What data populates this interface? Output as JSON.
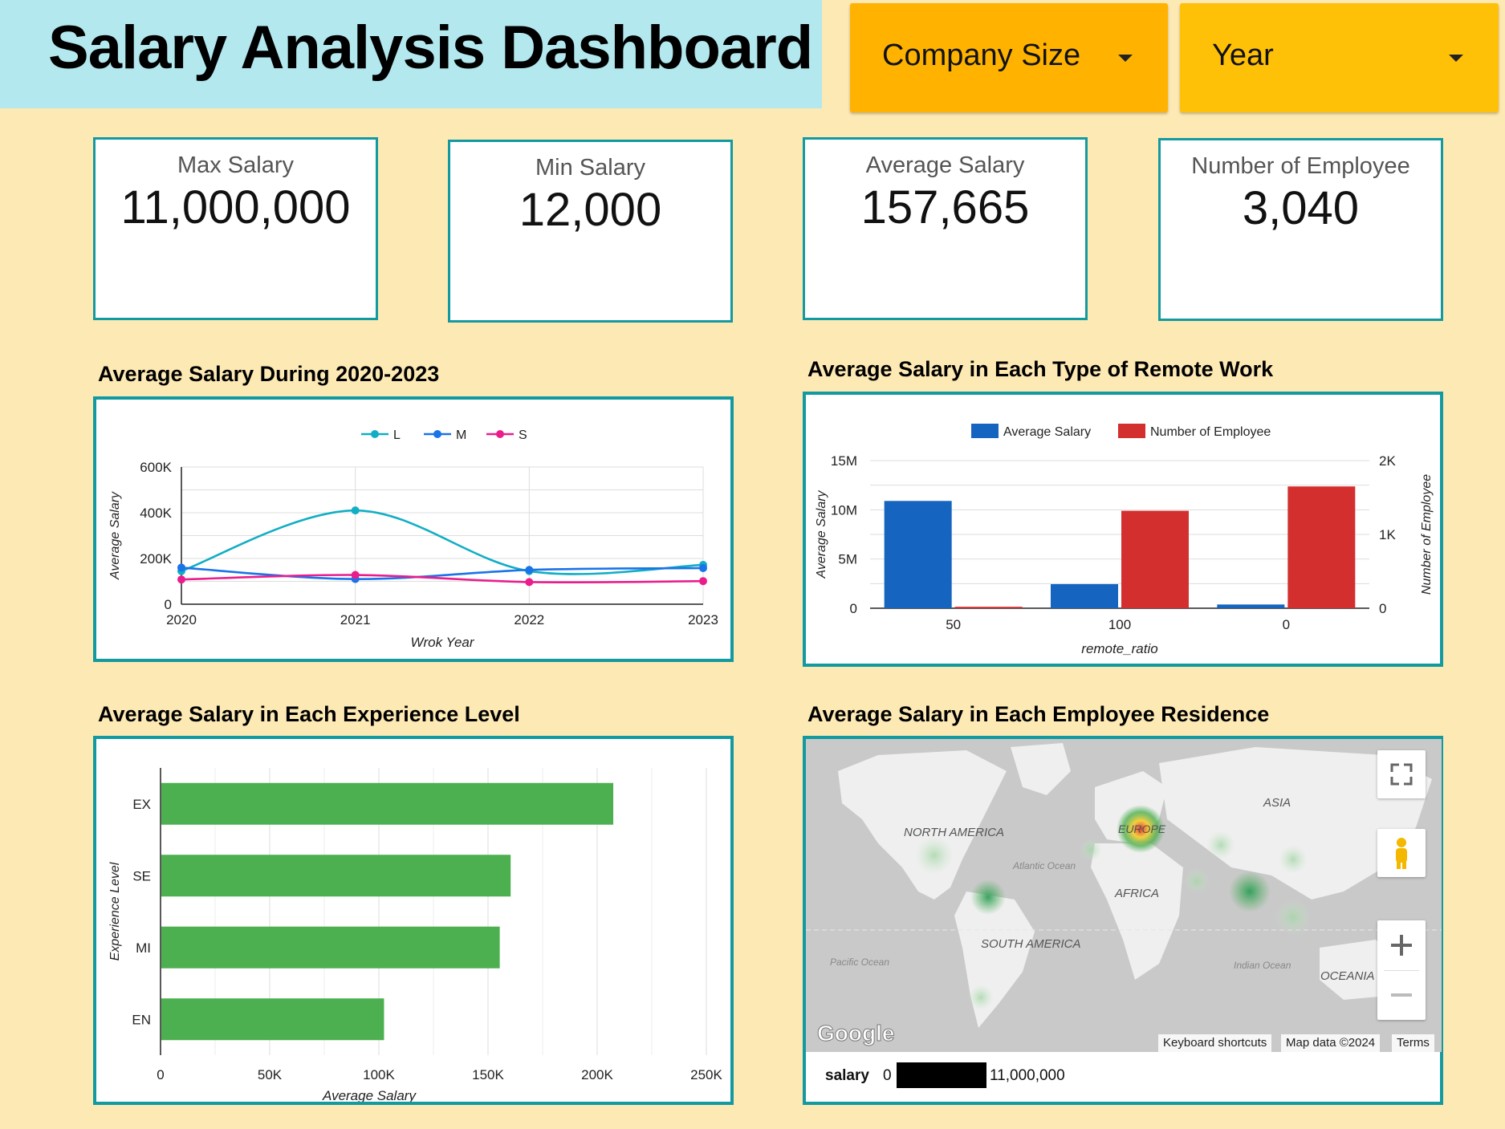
{
  "header": {
    "title": "Salary Analysis Dashboard"
  },
  "filters": {
    "company_size": "Company Size",
    "year": "Year"
  },
  "colors": {
    "teal": "#139aa0",
    "orange": "#ffb300",
    "yellow": "#ffc107",
    "blue": "#1565c0",
    "red": "#d32f2f",
    "green": "#4caf50",
    "pink": "#e91e8c",
    "cyan": "#12aec4"
  },
  "kpis": [
    {
      "label": "Max Salary",
      "value": "11,000,000"
    },
    {
      "label": "Min Salary",
      "value": "12,000"
    },
    {
      "label": "Average Salary",
      "value": "157,665"
    },
    {
      "label": "Number of Employee",
      "value": "3,040"
    }
  ],
  "sections": {
    "line": "Average Salary During 2020-2023",
    "combo": "Average Salary in Each Type of Remote Work",
    "bar": "Average Salary in Each Experience Level",
    "map": "Average Salary in Each Employee Residence"
  },
  "map": {
    "labels": [
      "NORTH AMERICA",
      "SOUTH AMERICA",
      "EUROPE",
      "AFRICA",
      "ASIA",
      "OCEANIA",
      "Atlantic Ocean",
      "Pacific Ocean",
      "Indian Ocean"
    ],
    "google": "Google",
    "attribution": [
      "Keyboard shortcuts",
      "Map data ©2024",
      "Terms"
    ],
    "legend": {
      "field": "salary",
      "min": "0",
      "max": "11,000,000"
    },
    "icons": [
      "fullscreen-icon",
      "pegman-icon",
      "zoom-in-icon",
      "zoom-out-icon"
    ]
  },
  "chart_data": [
    {
      "type": "line",
      "title": "Average Salary During 2020-2023",
      "xlabel": "Wrok Year",
      "ylabel": "Average Salary",
      "x": [
        "2020",
        "2021",
        "2022",
        "2023"
      ],
      "yticks": [
        "0",
        "200K",
        "400K",
        "600K"
      ],
      "ylim": [
        0,
        600000
      ],
      "series": [
        {
          "name": "L",
          "color": "#12aec4",
          "values": [
            145000,
            410000,
            145000,
            172000
          ]
        },
        {
          "name": "M",
          "color": "#1a73e8",
          "values": [
            160000,
            110000,
            150000,
            158000
          ]
        },
        {
          "name": "S",
          "color": "#e91e8c",
          "values": [
            108000,
            128000,
            97000,
            101000
          ]
        }
      ],
      "legend": "top"
    },
    {
      "type": "bar",
      "title": "Average Salary in Each Type of Remote Work",
      "xlabel": "remote_ratio",
      "ylabel": "Average Salary",
      "y2label": "Number of Employee",
      "categories": [
        "50",
        "100",
        "0"
      ],
      "yticks": [
        "0",
        "5M",
        "10M",
        "15M"
      ],
      "y2ticks": [
        "0",
        "1K",
        "2K"
      ],
      "ylim": [
        0,
        15000000
      ],
      "y2lim": [
        0,
        2000
      ],
      "series": [
        {
          "name": "Average Salary",
          "color": "#1565c0",
          "axis": "left",
          "values": [
            10900000,
            2450000,
            380000
          ]
        },
        {
          "name": "Number of Employee",
          "color": "#d32f2f",
          "axis": "right",
          "values": [
            20,
            1320,
            1650
          ]
        }
      ],
      "legend": "top"
    },
    {
      "type": "bar",
      "orientation": "horizontal",
      "title": "Average Salary in Each Experience Level",
      "xlabel": "Average Salary",
      "ylabel": "Experience Level",
      "categories": [
        "EX",
        "SE",
        "MI",
        "EN"
      ],
      "values": [
        207000,
        160000,
        155000,
        102000
      ],
      "xticks": [
        "0",
        "50K",
        "100K",
        "150K",
        "200K",
        "250K"
      ],
      "xlim": [
        0,
        250000
      ],
      "color": "#4caf50"
    }
  ]
}
